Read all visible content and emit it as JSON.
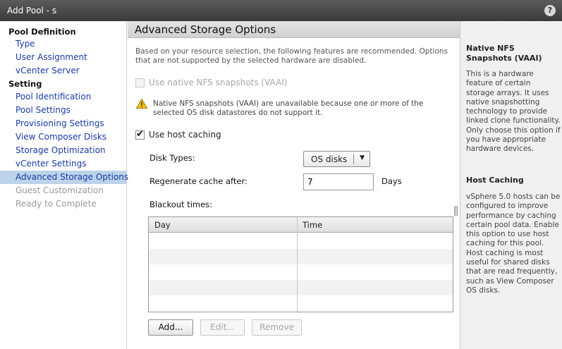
{
  "window": {
    "title": "Add Pool - s"
  },
  "sidebar": {
    "sections": [
      {
        "heading": "Pool Definition",
        "items": [
          "Type",
          "User Assignment",
          "vCenter Server"
        ]
      },
      {
        "heading": "Setting",
        "items": [
          "Pool Identification",
          "Pool Settings",
          "Provisioning Settings",
          "View Composer Disks",
          "Storage Optimization",
          "vCenter Settings",
          "Advanced Storage Options",
          "Guest Customization",
          "Ready to Complete"
        ]
      }
    ],
    "active_item": "Advanced Storage Options",
    "disabled_items": [
      "Guest Customization",
      "Ready to Complete"
    ]
  },
  "main": {
    "header": "Advanced Storage Options",
    "intro": "Based on your resource selection, the following features are recommended. Options that are not supported by the selected hardware are disabled.",
    "nfs_checkbox": {
      "label": "Use native NFS snapshots (VAAI)",
      "checked": false,
      "disabled": true
    },
    "warning": "Native NFS snapshots (VAAI) are unavailable because one or more of the selected OS disk datastores do not support it.",
    "host_caching_checkbox": {
      "label": "Use host caching",
      "checked": true
    },
    "disk_types": {
      "label": "Disk Types:",
      "value": "OS disks"
    },
    "regenerate": {
      "label": "Regenerate cache after:",
      "value": "7",
      "unit": "Days"
    },
    "blackout": {
      "label": "Blackout times:",
      "columns": [
        "Day",
        "Time"
      ],
      "rows": []
    },
    "buttons": {
      "add": "Add...",
      "edit": "Edit...",
      "remove": "Remove"
    }
  },
  "help": {
    "sections": [
      {
        "title": "Native NFS Snapshots (VAAI)",
        "body": "This is a hardware feature of certain storage arrays. It uses native snapshotting technology to provide linked clone functionality. Only choose this option if you have appropriate hardware devices."
      },
      {
        "title": "Host Caching",
        "body": "vSphere 5.0 hosts can be configured to improve performance by caching certain pool data. Enable this option to use host caching for this pool. Host caching is most useful for shared disks that are read frequently, such as View Composer OS disks."
      }
    ]
  },
  "colors": {
    "titlebar": "#3a3a3a",
    "link": "#1a3aa8",
    "active_bg": "#bcd3ea",
    "help_bg": "#f0f0f0"
  }
}
